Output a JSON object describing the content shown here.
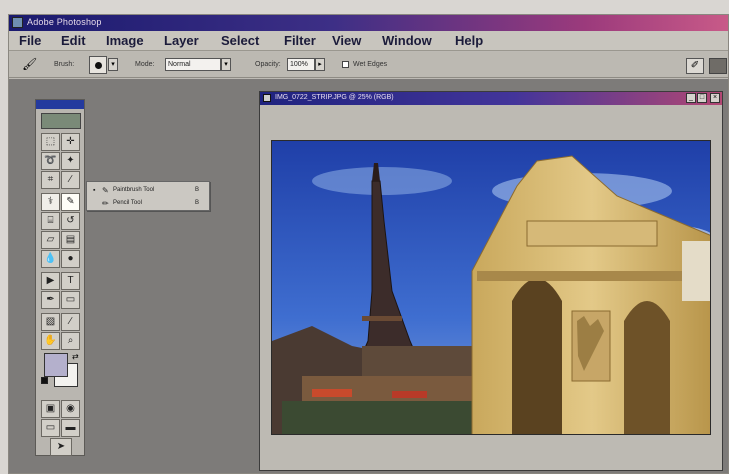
{
  "app": {
    "title": "Adobe Photoshop"
  },
  "menubar": {
    "items": [
      "File",
      "Edit",
      "Image",
      "Layer",
      "Select",
      "Filter",
      "View",
      "Window",
      "Help"
    ]
  },
  "options": {
    "brush_label": "Brush:",
    "mode_label": "Mode:",
    "mode_value": "Normal",
    "opacity_label": "Opacity:",
    "opacity_value": "100%",
    "wet_edges_label": "Wet Edges"
  },
  "toolbox": {
    "tools": [
      "marquee-tool",
      "move-tool",
      "lasso-tool",
      "magic-wand-tool",
      "crop-tool",
      "eyedropper-tool",
      "brush-tool",
      "pencil-tool",
      "clone-stamp-tool",
      "history-brush-tool",
      "eraser-tool",
      "gradient-tool",
      "blur-tool",
      "dodge-tool",
      "path-select-tool",
      "type-tool",
      "pen-tool",
      "shape-tool",
      "notes-tool",
      "eyedropper2-tool",
      "hand-tool",
      "zoom-tool"
    ]
  },
  "flyout": {
    "items": [
      {
        "label": "Paintbrush Tool",
        "key": "B",
        "selected": true
      },
      {
        "label": "Pencil Tool",
        "key": "B",
        "selected": false
      }
    ]
  },
  "document": {
    "title": "IMG_0722_STRIP.JPG @ 25% (RGB)"
  },
  "colors": {
    "foreground": "#b4b0cc",
    "background": "#f3f2ef",
    "titlebar": "#1a1a6e"
  }
}
